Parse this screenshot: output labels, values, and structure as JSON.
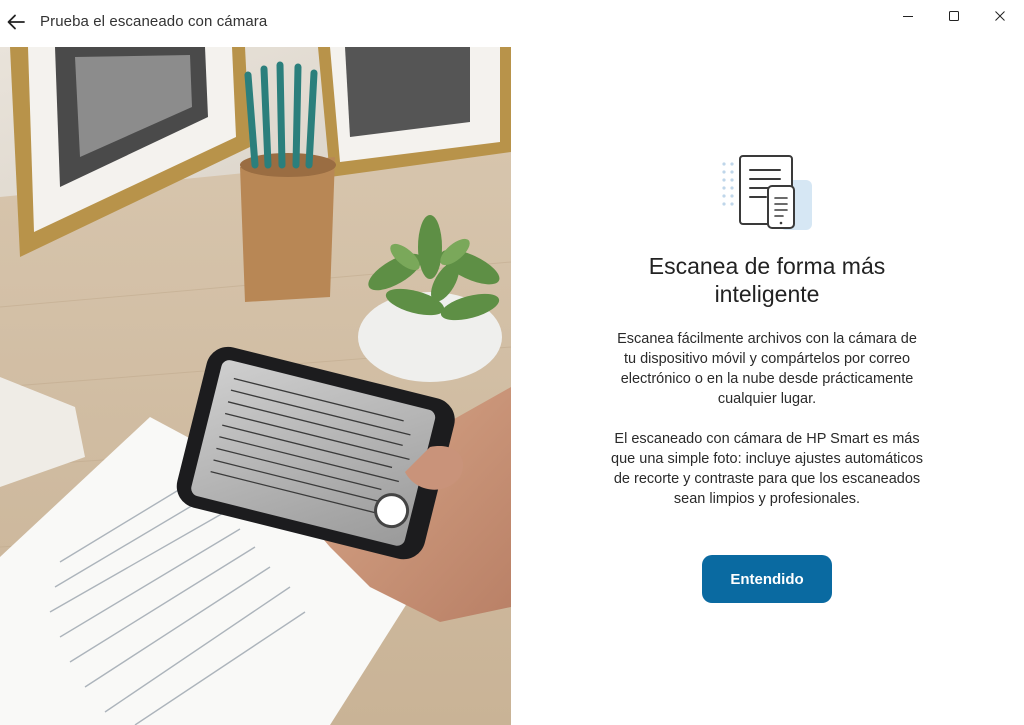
{
  "window": {
    "title": "Prueba el escaneado con cámara",
    "controls": [
      "minimize",
      "maximize",
      "close"
    ]
  },
  "icons": {
    "back": "arrow-left-icon",
    "minimize": "minimize-icon",
    "maximize": "maximize-icon",
    "close": "close-icon",
    "illustration": "document-phone-scan-icon"
  },
  "main": {
    "heading": "Escanea de forma más inteligente",
    "paragraph1": "Escanea fácilmente archivos con la cámara de tu dispositivo móvil y compártelos por correo electrónico o en la nube desde prácticamente cualquier lugar.",
    "paragraph2": "El escaneado con cámara de HP Smart es más que una simple foto: incluye ajustes automáticos de recorte y contraste para que los escaneados sean limpios y profesionales.",
    "button_label": "Entendido"
  },
  "colors": {
    "accent": "#0a6aa1",
    "background": "#ffffff",
    "text": "#222222"
  }
}
